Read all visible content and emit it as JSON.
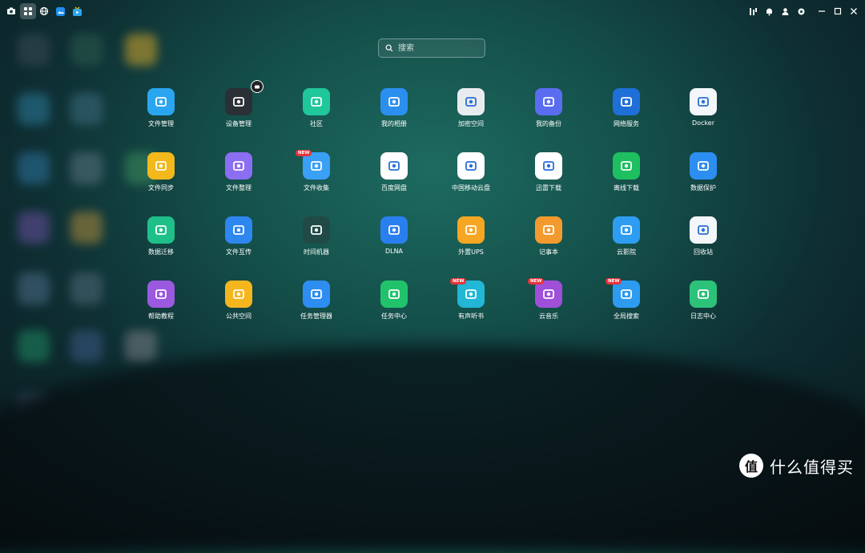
{
  "topbar": {
    "left_icons": [
      "camera-icon",
      "apps-grid-icon",
      "globe-icon",
      "cloud-photo-icon",
      "tv-icon"
    ],
    "right_icons": [
      "tools-icon",
      "bell-icon",
      "user-icon",
      "settings-icon",
      "minimize-icon",
      "maximize-icon",
      "close-icon"
    ]
  },
  "search": {
    "placeholder": "搜索"
  },
  "apps": [
    {
      "label": "文件管理",
      "icon": "folder-icon",
      "color": "#2aa5f0"
    },
    {
      "label": "设备管理",
      "icon": "device-icon",
      "color": "#2b2f36",
      "corner": true
    },
    {
      "label": "社区",
      "icon": "chat-smile-icon",
      "color": "#1fc79b"
    },
    {
      "label": "我的相册",
      "icon": "photo-icon",
      "color": "#2b8ff0"
    },
    {
      "label": "加密空间",
      "icon": "lock-icon",
      "color": "#e9ecef"
    },
    {
      "label": "我的备份",
      "icon": "backup-icon",
      "color": "#5a6df0"
    },
    {
      "label": "网络服务",
      "icon": "wifi-icon",
      "color": "#1f6fd8"
    },
    {
      "label": "Docker",
      "icon": "docker-icon",
      "color": "#f4f7fa"
    },
    {
      "label": "文件同步",
      "icon": "sync-icon",
      "color": "#f2b81c"
    },
    {
      "label": "文件整理",
      "icon": "organize-icon",
      "color": "#8c6ef2"
    },
    {
      "label": "文件收集",
      "icon": "inbox-icon",
      "color": "#3aa0f5",
      "new": true
    },
    {
      "label": "百度网盘",
      "icon": "baidu-pan-icon",
      "color": "#ffffff"
    },
    {
      "label": "中国移动云盘",
      "icon": "cmcc-cloud-icon",
      "color": "#ffffff"
    },
    {
      "label": "迅雷下载",
      "icon": "thunder-icon",
      "color": "#ffffff"
    },
    {
      "label": "离线下载",
      "icon": "download-icon",
      "color": "#1dbf5f"
    },
    {
      "label": "数据保护",
      "icon": "shield-icon",
      "color": "#2c8ef0"
    },
    {
      "label": "数据迁移",
      "icon": "migrate-icon",
      "color": "#1fbf8a"
    },
    {
      "label": "文件互传",
      "icon": "airdrop-icon",
      "color": "#2e86ef"
    },
    {
      "label": "时间机器",
      "icon": "time-machine-icon",
      "color": "#214a46"
    },
    {
      "label": "DLNA",
      "icon": "dlna-icon",
      "color": "#2a7ff0"
    },
    {
      "label": "外置UPS",
      "icon": "ups-icon",
      "color": "#f5a623"
    },
    {
      "label": "记事本",
      "icon": "notepad-icon",
      "color": "#f29a2e"
    },
    {
      "label": "云影院",
      "icon": "cinema-icon",
      "color": "#2e9cf0"
    },
    {
      "label": "回收站",
      "icon": "trash-icon",
      "color": "#f4f7fa"
    },
    {
      "label": "帮助教程",
      "icon": "help-icon",
      "color": "#9b59e0"
    },
    {
      "label": "公共空间",
      "icon": "shared-folder-icon",
      "color": "#f5b51d"
    },
    {
      "label": "任务管理器",
      "icon": "task-manager-icon",
      "color": "#2e8df0"
    },
    {
      "label": "任务中心",
      "icon": "task-center-icon",
      "color": "#20c36c"
    },
    {
      "label": "有声听书",
      "icon": "audiobook-icon",
      "color": "#22b7d6",
      "new": true
    },
    {
      "label": "云音乐",
      "icon": "music-icon",
      "color": "#a04fd9",
      "new": true
    },
    {
      "label": "全局搜索",
      "icon": "global-search-icon",
      "color": "#2c9bf0",
      "new": true
    },
    {
      "label": "日志中心",
      "icon": "log-icon",
      "color": "#2cc27a"
    }
  ],
  "badges": {
    "new_text": "NEW"
  },
  "watermark": {
    "text": "什么值得买",
    "logo": "值"
  }
}
